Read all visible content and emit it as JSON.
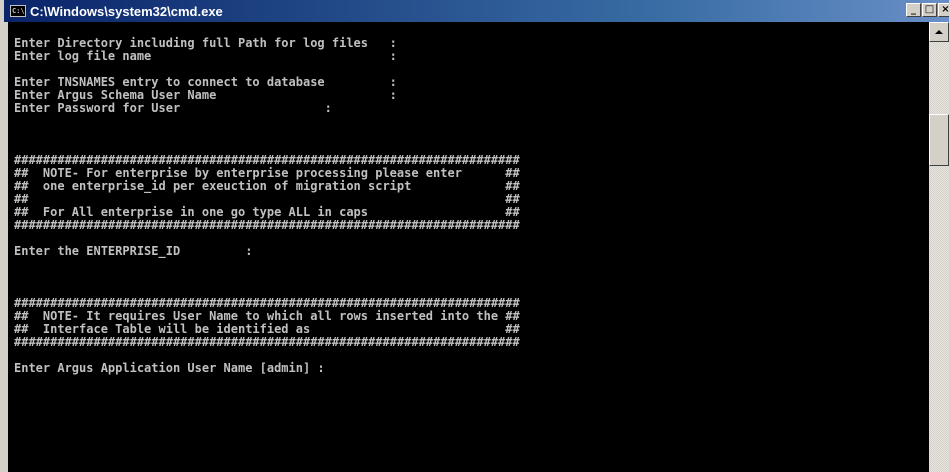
{
  "window": {
    "title": "C:\\Windows\\system32\\cmd.exe",
    "icon": "cmd-icon",
    "buttons": {
      "minimize": "_",
      "maximize": "□",
      "close": "×"
    }
  },
  "console": {
    "lines": [
      "",
      "Enter Directory including full Path for log files   :",
      "Enter log file name                                 :",
      "",
      "Enter TNSNAMES entry to connect to database         :",
      "Enter Argus Schema User Name                        :",
      "Enter Password for User                    :",
      "",
      "",
      "",
      "######################################################################",
      "##  NOTE- For enterprise by enterprise processing please enter      ##",
      "##  one enterprise_id per exeuction of migration script             ##",
      "##                                                                  ##",
      "##  For All enterprise in one go type ALL in caps                   ##",
      "######################################################################",
      "",
      "Enter the ENTERPRISE_ID         :",
      "",
      "",
      "",
      "######################################################################",
      "##  NOTE- It requires User Name to which all rows inserted into the ##",
      "##  Interface Table will be identified as                           ##",
      "######################################################################",
      "",
      "Enter Argus Application User Name [admin] :"
    ]
  },
  "scrollbar": {
    "up_icon": "arrow-up-icon"
  }
}
